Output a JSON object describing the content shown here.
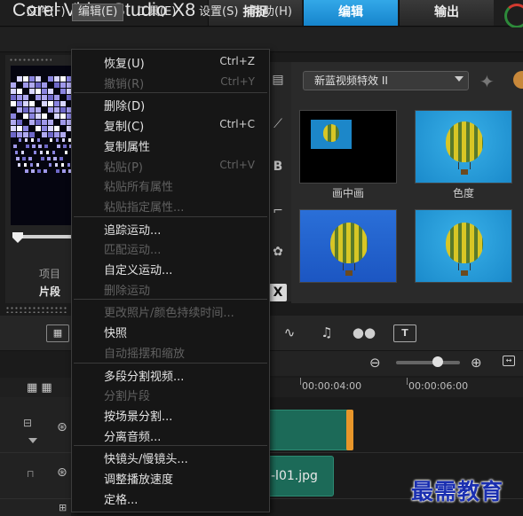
{
  "app": {
    "title": "Corel VideoStudio X8",
    "step_tabs": [
      "捕捉",
      "编辑",
      "输出"
    ],
    "active_step_tab": "编辑"
  },
  "menubar": {
    "items": [
      "文件(F)",
      "编辑(E)",
      "工具(E)",
      "设置(S)",
      "帮助(H)"
    ],
    "open_item": "编辑(E)"
  },
  "player": {
    "mode_project": "项目",
    "mode_clip": "片段"
  },
  "library": {
    "filter_value": "新蓝视频特效 II",
    "thumbnails": [
      {
        "label": "画中画"
      },
      {
        "label": "色度"
      },
      {
        "label": ""
      },
      {
        "label": ""
      }
    ]
  },
  "timeline": {
    "ruler_labels": [
      "00:00:04:00",
      "00:00:06:00"
    ],
    "overlay_clip_text": "-l01.jpg"
  },
  "edit_menu": {
    "items": [
      {
        "label": "恢复(U)",
        "shortcut": "Ctrl+Z",
        "enabled": true
      },
      {
        "label": "撤销(R)",
        "shortcut": "Ctrl+Y",
        "enabled": false
      },
      {
        "sep": true
      },
      {
        "label": "删除(D)",
        "shortcut": "",
        "enabled": true
      },
      {
        "label": "复制(C)",
        "shortcut": "Ctrl+C",
        "enabled": true
      },
      {
        "label": "复制属性",
        "shortcut": "",
        "enabled": true
      },
      {
        "label": "粘贴(P)",
        "shortcut": "Ctrl+V",
        "enabled": false
      },
      {
        "label": "粘贴所有属性",
        "shortcut": "",
        "enabled": false
      },
      {
        "label": "粘贴指定属性...",
        "shortcut": "",
        "enabled": false
      },
      {
        "sep": true
      },
      {
        "label": "追踪运动...",
        "shortcut": "",
        "enabled": true
      },
      {
        "label": "匹配运动...",
        "shortcut": "",
        "enabled": false
      },
      {
        "label": "自定义运动...",
        "shortcut": "",
        "enabled": true
      },
      {
        "label": "删除运动",
        "shortcut": "",
        "enabled": false
      },
      {
        "sep": true
      },
      {
        "label": "更改照片/颜色持续时间...",
        "shortcut": "",
        "enabled": false
      },
      {
        "label": "快照",
        "shortcut": "",
        "enabled": true
      },
      {
        "label": "自动摇摆和缩放",
        "shortcut": "",
        "enabled": false
      },
      {
        "sep": true
      },
      {
        "label": "多段分割视频...",
        "shortcut": "",
        "enabled": true
      },
      {
        "label": "分割片段",
        "shortcut": "",
        "enabled": false
      },
      {
        "label": "按场景分割...",
        "shortcut": "",
        "enabled": true
      },
      {
        "label": "分离音频...",
        "shortcut": "",
        "enabled": true
      },
      {
        "sep": true
      },
      {
        "label": "快镜头/慢镜头...",
        "shortcut": "",
        "enabled": true
      },
      {
        "label": "调整播放速度",
        "shortcut": "",
        "enabled": true
      },
      {
        "label": "定格...",
        "shortcut": "",
        "enabled": true
      }
    ]
  },
  "watermark": "最需教育",
  "colors": {
    "accent": "#1684cc",
    "background": "#1b1b1b",
    "clip": "#1c6a58",
    "watermark": "#1a2fb0"
  }
}
